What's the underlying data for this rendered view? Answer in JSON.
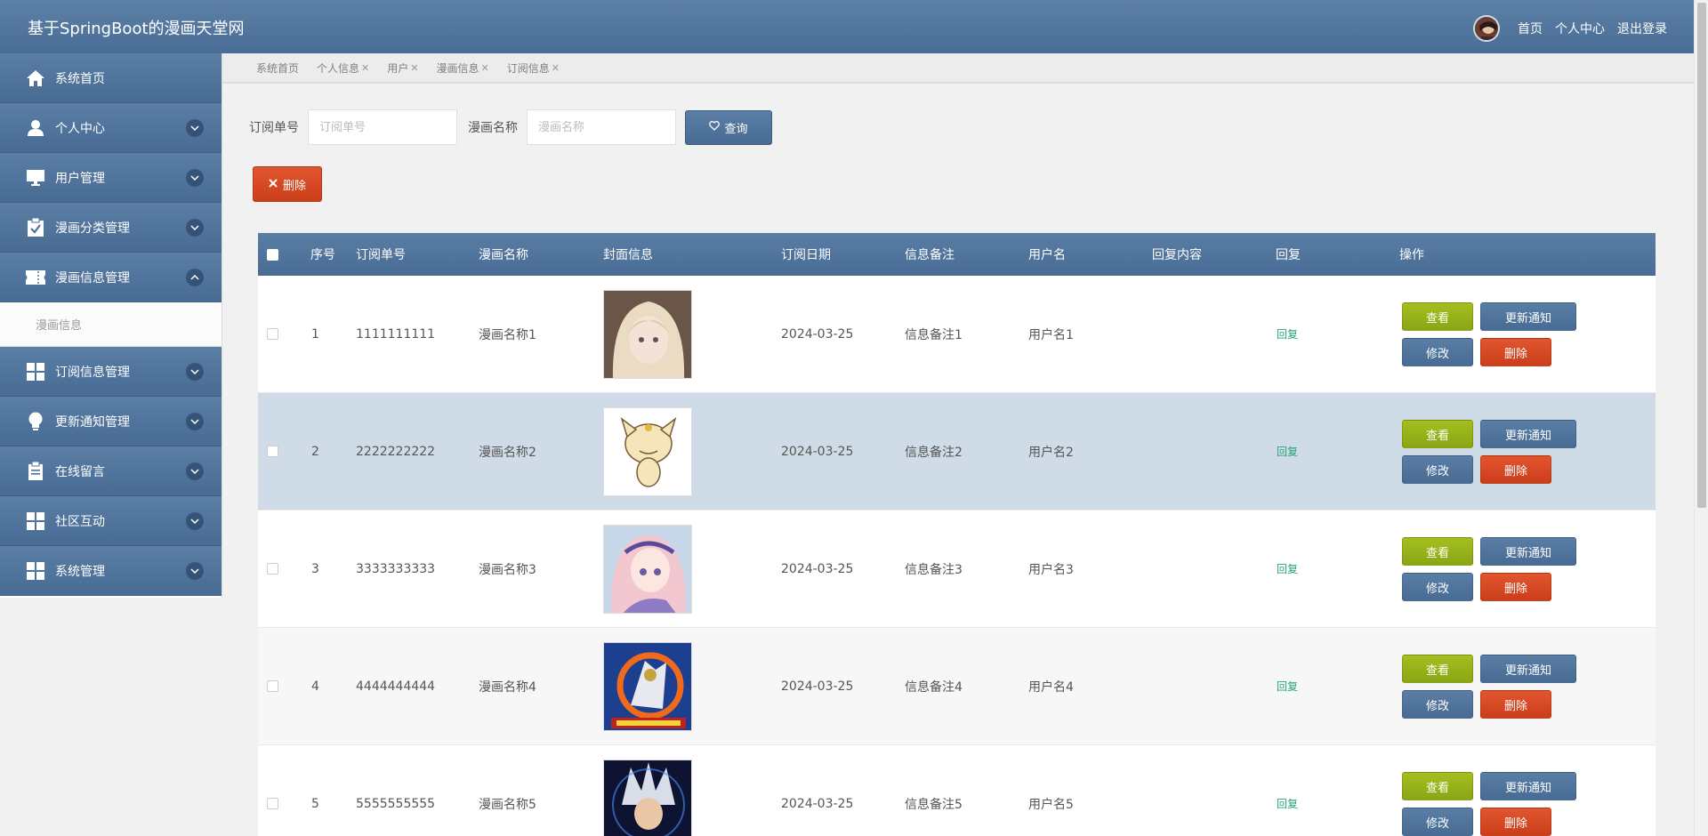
{
  "header": {
    "brand": "基于SpringBoot的漫画天堂网",
    "nav": [
      "首页",
      "个人中心",
      "退出登录"
    ]
  },
  "sidebar": {
    "items": [
      {
        "label": "系统首页",
        "icon": "home-icon",
        "chevron": "none"
      },
      {
        "label": "个人中心",
        "icon": "user-icon",
        "chevron": "down"
      },
      {
        "label": "用户管理",
        "icon": "monitor-icon",
        "chevron": "down"
      },
      {
        "label": "漫画分类管理",
        "icon": "clipboard-check-icon",
        "chevron": "down"
      },
      {
        "label": "漫画信息管理",
        "icon": "ticket-icon",
        "chevron": "up"
      },
      {
        "label": "订阅信息管理",
        "icon": "grid-icon",
        "chevron": "down"
      },
      {
        "label": "更新通知管理",
        "icon": "lightbulb-icon",
        "chevron": "down"
      },
      {
        "label": "在线留言",
        "icon": "clipboard-icon",
        "chevron": "down"
      },
      {
        "label": "社区互动",
        "icon": "grid-icon",
        "chevron": "down"
      },
      {
        "label": "系统管理",
        "icon": "grid-icon",
        "chevron": "down"
      }
    ],
    "sub_item": "漫画信息"
  },
  "tabs": [
    {
      "label": "系统首页",
      "closable": false
    },
    {
      "label": "个人信息",
      "closable": true
    },
    {
      "label": "用户",
      "closable": true
    },
    {
      "label": "漫画信息",
      "closable": true
    },
    {
      "label": "订阅信息",
      "closable": true
    }
  ],
  "search": {
    "order_label": "订阅单号",
    "order_placeholder": "订阅单号",
    "name_label": "漫画名称",
    "name_placeholder": "漫画名称",
    "query_button": "查询"
  },
  "delete_button": "删除",
  "table": {
    "headers": [
      "序号",
      "订阅单号",
      "漫画名称",
      "封面信息",
      "订阅日期",
      "信息备注",
      "用户名",
      "回复内容",
      "回复",
      "操作"
    ],
    "rows": [
      {
        "index": "1",
        "order_no": "1111111111",
        "name": "漫画名称1",
        "date": "2024-03-25",
        "note": "信息备注1",
        "user": "用户名1",
        "reply_content": "",
        "reply": "回复"
      },
      {
        "index": "2",
        "order_no": "2222222222",
        "name": "漫画名称2",
        "date": "2024-03-25",
        "note": "信息备注2",
        "user": "用户名2",
        "reply_content": "",
        "reply": "回复"
      },
      {
        "index": "3",
        "order_no": "3333333333",
        "name": "漫画名称3",
        "date": "2024-03-25",
        "note": "信息备注3",
        "user": "用户名3",
        "reply_content": "",
        "reply": "回复"
      },
      {
        "index": "4",
        "order_no": "4444444444",
        "name": "漫画名称4",
        "date": "2024-03-25",
        "note": "信息备注4",
        "user": "用户名4",
        "reply_content": "",
        "reply": "回复"
      },
      {
        "index": "5",
        "order_no": "5555555555",
        "name": "漫画名称5",
        "date": "2024-03-25",
        "note": "信息备注5",
        "user": "用户名5",
        "reply_content": "",
        "reply": "回复"
      }
    ],
    "actions": {
      "view": "查看",
      "notify": "更新通知",
      "edit": "修改",
      "delete": "删除"
    }
  },
  "colors": {
    "primary": "#4f739c",
    "success": "#9bb51a",
    "danger": "#d7472a",
    "reply_link": "#25a57c",
    "highlight_row": "#cfdbe6"
  }
}
